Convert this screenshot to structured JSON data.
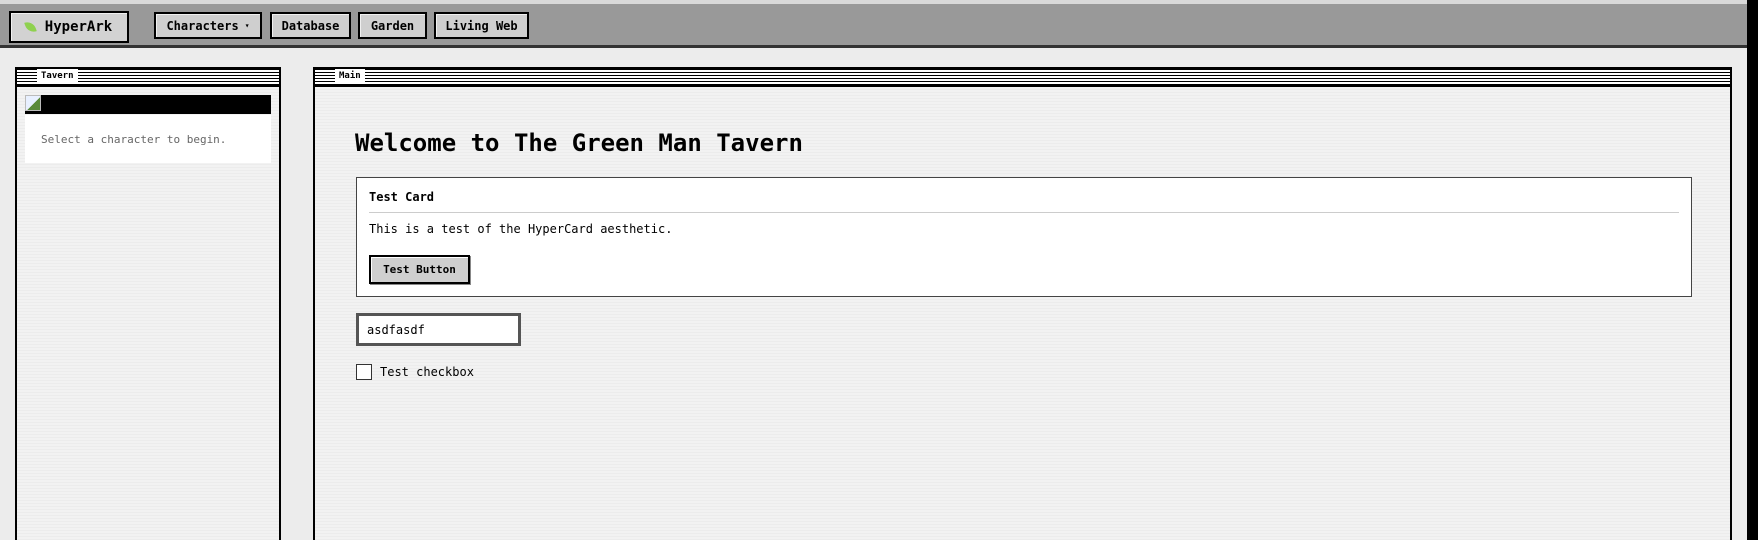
{
  "nav": {
    "brand": "HyperArk",
    "items": [
      "Characters",
      "Database",
      "Garden",
      "Living Web"
    ],
    "caret": "▾"
  },
  "tavern": {
    "title": "Tavern",
    "prompt": "Select a character to begin."
  },
  "main": {
    "title": "Main",
    "welcome": "Welcome to The Green Man Tavern",
    "card": {
      "title": "Test Card",
      "body": "This is a test of the HyperCard aesthetic.",
      "button": "Test Button"
    },
    "input_value": "asdfasdf",
    "checkbox_label": "Test checkbox",
    "checkbox_checked": false
  }
}
